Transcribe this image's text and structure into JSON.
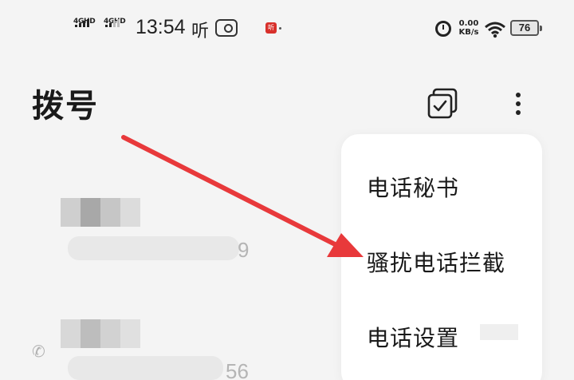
{
  "status_bar": {
    "sim1_label": "4GHD",
    "sim2_label": "4GHD",
    "time": "13:54",
    "ting_icon_text": "听",
    "app_icon_text": "听",
    "net_speed_value": "0.00",
    "net_speed_unit": "KB/s",
    "battery_level": "76"
  },
  "header": {
    "title": "拨号"
  },
  "menu": {
    "items": [
      {
        "label": "电话秘书"
      },
      {
        "label": "骚扰电话拦截"
      },
      {
        "label": "电话设置"
      }
    ]
  },
  "call_list": {
    "items": [
      {
        "number_suffix": "9"
      },
      {
        "number_suffix": "56"
      }
    ]
  },
  "colors": {
    "background": "#f4f4f4",
    "menu_background": "#ffffff",
    "annotation_arrow": "#e8393b",
    "recording_app": "#d8302b"
  },
  "icons": {
    "multiselect": "checkbox-stack-icon",
    "more": "vertical-ellipsis-icon",
    "alarm": "alarm-clock-icon",
    "wifi": "wifi-icon",
    "battery": "battery-icon",
    "call_type": "incoming-call-icon"
  }
}
